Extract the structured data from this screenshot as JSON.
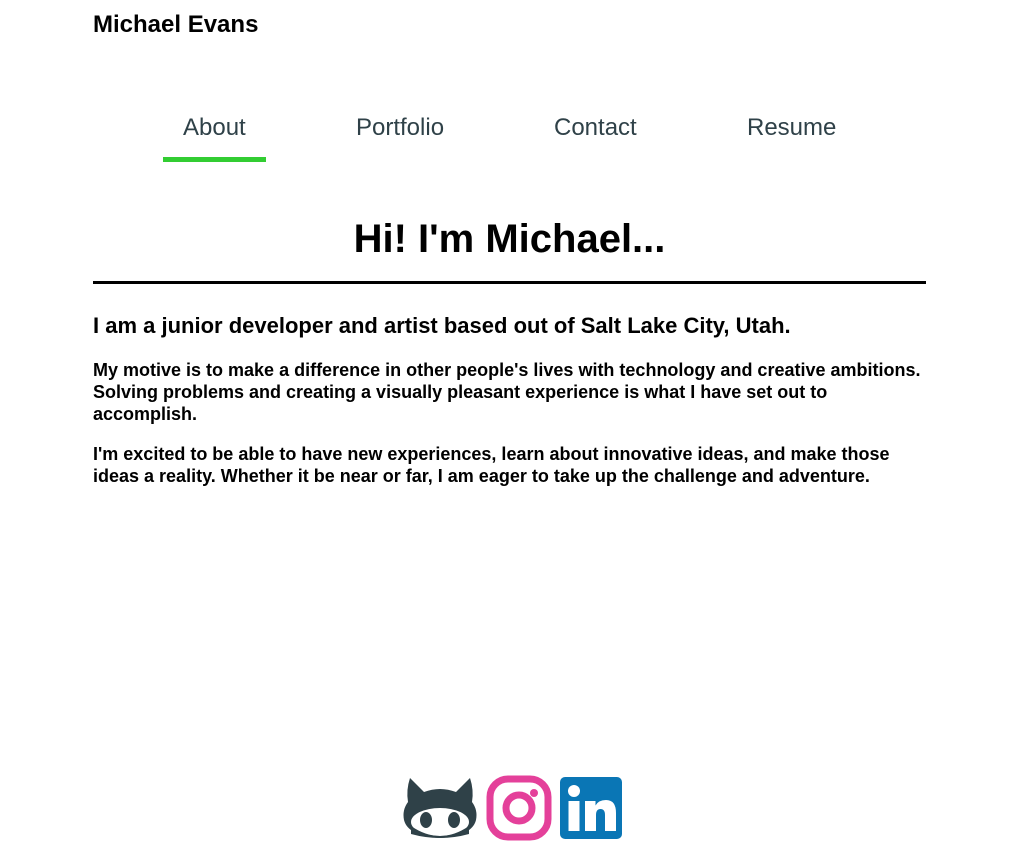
{
  "header": {
    "site_name": "Michael Evans"
  },
  "nav": {
    "items": [
      {
        "label": "About",
        "active": true
      },
      {
        "label": "Portfolio",
        "active": false
      },
      {
        "label": "Contact",
        "active": false
      },
      {
        "label": "Resume",
        "active": false
      }
    ],
    "active_color": "#32cd32",
    "link_color": "#2f4148"
  },
  "main": {
    "title": "Hi! I'm Michael...",
    "intro": "I am a junior developer and artist based out of Salt Lake City, Utah.",
    "paragraphs": [
      "My motive is to make a difference in other people's lives with technology and creative ambitions. Solving problems and creating a visually pleasant experience is what I have set out to accomplish.",
      "I'm excited to be able to have new experiences, learn about innovative ideas, and make those ideas a reality. Whether it be near or far, I am eager to take up the challenge and adventure."
    ]
  },
  "footer": {
    "socials": [
      {
        "name": "github-icon",
        "color": "#2f4148"
      },
      {
        "name": "instagram-icon",
        "color": "#e4409a"
      },
      {
        "name": "linkedin-icon",
        "color": "#0a76b5"
      }
    ]
  }
}
